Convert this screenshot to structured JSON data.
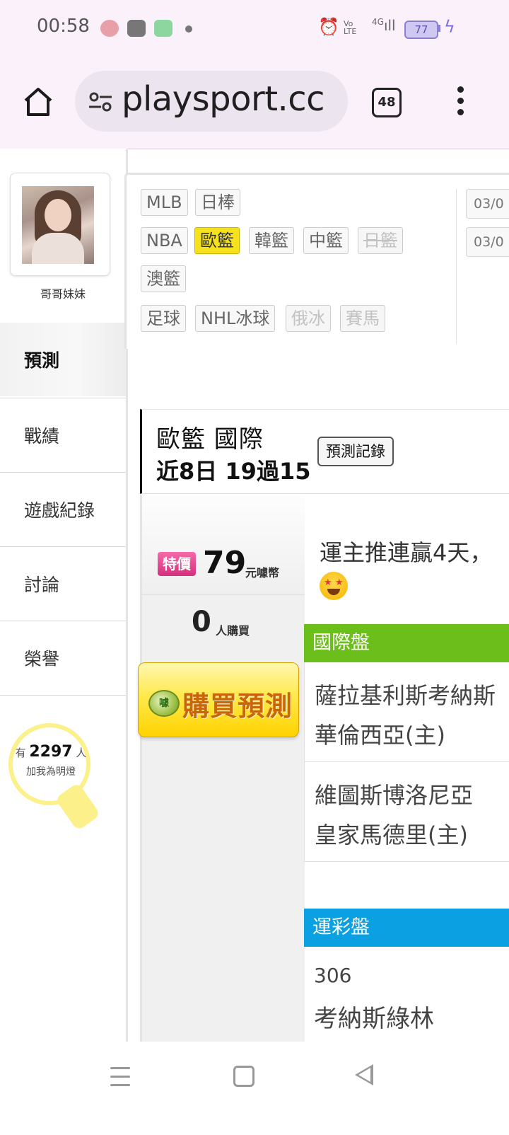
{
  "status_bar": {
    "time": "00:58",
    "network": "4G",
    "volte": "Vo LTE",
    "battery": "77"
  },
  "browser": {
    "url": "playsport.cc",
    "tab_count": "48"
  },
  "sidebar": {
    "nickname": "哥哥妹妹",
    "nav": [
      "預測",
      "戰績",
      "遊戲紀錄",
      "討論",
      "榮譽"
    ],
    "supporters_prefix": "有",
    "supporters_count": "2297",
    "supporters_suffix": "人",
    "supporters_label": "加我為明燈"
  },
  "leagues": {
    "row1": [
      "MLB",
      "日棒"
    ],
    "row2": [
      "NBA",
      "歐籃",
      "韓籃",
      "中籃",
      "日籃"
    ],
    "row3": [
      "澳籃"
    ],
    "row4": [
      "足球",
      "NHL冰球",
      "俄冰",
      "賽馬"
    ],
    "active": "歐籃",
    "dates": [
      "03/0",
      "03/0"
    ]
  },
  "headline": {
    "title": "歐籃 國際",
    "stat": "近8日 19過15",
    "record_button": "預測記錄"
  },
  "purchase": {
    "badge": "特價",
    "price": "79",
    "price_unit": "元噱幣",
    "buyers": "0",
    "buyers_label": "人購買",
    "coin": "噱",
    "buy_button": "購買預測"
  },
  "promo_text": "運主推連贏4天，",
  "sections": {
    "intl": {
      "header": "國際盤",
      "matches": [
        [
          "薩拉基利斯考納斯",
          "華倫西亞(主)"
        ],
        [
          "維圖斯博洛尼亞",
          "皇家馬德里(主)"
        ]
      ]
    },
    "lottery": {
      "header": "運彩盤",
      "code": "306",
      "team": "考納斯綠林"
    }
  },
  "colors": {
    "active_tag": "#f6e21c",
    "intl_header": "#6cbf1a",
    "lottery_header": "#0aa0e2",
    "sale_badge": "#d5307e",
    "buy_button": "#ffd200"
  }
}
